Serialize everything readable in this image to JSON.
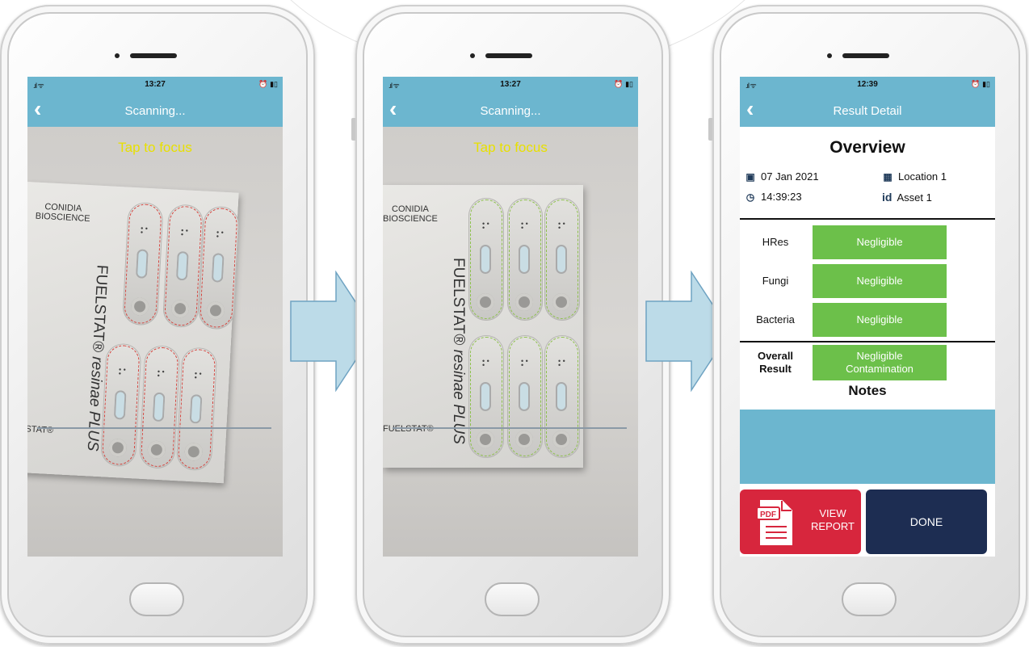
{
  "screens": [
    {
      "status_time": "13:27",
      "nav_title": "Scanning...",
      "tap_text": "Tap to focus"
    },
    {
      "status_time": "13:27",
      "nav_title": "Scanning...",
      "tap_text": "Tap to focus"
    },
    {
      "status_time": "12:39",
      "nav_title": "Result Detail"
    }
  ],
  "status": {
    "signal": ".ıl ᯤ",
    "battery": "⏰ ▮▯"
  },
  "back_glyph": "‹",
  "test_card": {
    "brand_line1": "CONIDIA",
    "brand_line2": "BIOSCIENCE",
    "product_brand": "FUELSTAT",
    "product_reg": "®",
    "product_name": "resinae PLUS",
    "footer_brand": "FUELSTAT®",
    "footer_brand_cut": "ELSTAT®"
  },
  "result": {
    "overview_title": "Overview",
    "date": "07 Jan 2021",
    "time": "14:39:23",
    "location": "Location 1",
    "asset": "Asset 1",
    "asset_icon_text": "id",
    "rows": [
      {
        "label": "HRes",
        "value": "Negligible"
      },
      {
        "label": "Fungi",
        "value": "Negligible"
      },
      {
        "label": "Bacteria",
        "value": "Negligible"
      }
    ],
    "overall_label_1": "Overall",
    "overall_label_2": "Result",
    "overall_value_1": "Negligible",
    "overall_value_2": "Contamination",
    "notes_title": "Notes",
    "view_report_1": "VIEW",
    "view_report_2": "REPORT",
    "pdf_badge": "PDF",
    "done": "DONE"
  },
  "colors": {
    "nav": "#6cb6cf",
    "negligible": "#6cc04a",
    "report_button": "#d7263d",
    "done_button": "#1d2d52",
    "tap_text": "#e8e000",
    "arrow_fill": "#bcdbe8",
    "arrow_stroke": "#6fa3c2"
  }
}
